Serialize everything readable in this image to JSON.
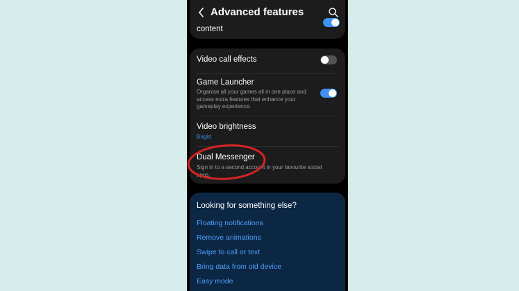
{
  "header": {
    "title": "Advanced features"
  },
  "top_item": {
    "title_fragment": "content",
    "toggle_on": true
  },
  "settings": [
    {
      "title": "Video call effects",
      "toggle_on": false
    },
    {
      "title": "Game Launcher",
      "description": "Organise all your games all in one place and access extra features that enhance your gameplay experience.",
      "toggle_on": true
    },
    {
      "title": "Video brightness",
      "subtitle": "Bright"
    },
    {
      "title": "Dual Messenger",
      "description": "Sign in to a second account in your favourite social apps."
    }
  ],
  "suggestions": {
    "title": "Looking for something else?",
    "links": [
      "Floating notifications",
      "Remove animations",
      "Swipe to call or text",
      "Bring data from old device",
      "Easy mode"
    ]
  },
  "colors": {
    "background": "#d6ecea",
    "accent": "#3e91f8",
    "link": "#4ea0ff",
    "annotation": "#d62424"
  },
  "icons": [
    "back-arrow-icon",
    "search-icon"
  ]
}
